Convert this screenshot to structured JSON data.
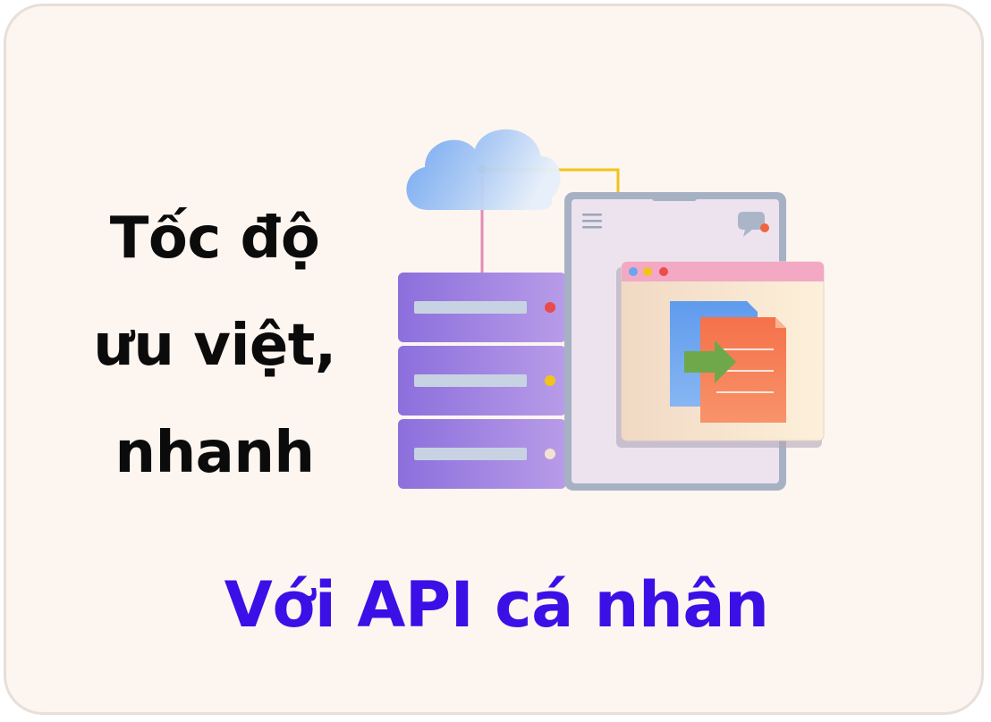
{
  "card": {
    "background": "#fdf5ef",
    "border_color": "#e6dfda"
  },
  "headline": {
    "line1": "Tốc độ",
    "line2": "ưu việt,",
    "line3": "nhanh",
    "color": "#0b0b0b"
  },
  "subtitle": {
    "text": "Với API cá nhân",
    "color": "#3a10e6"
  },
  "illustration": {
    "description_icons": [
      "cloud-icon",
      "server-stack-icon",
      "browser-window-icon",
      "document-transfer-icon",
      "chat-bubble-icon",
      "menu-icon"
    ],
    "colors": {
      "cloud": "#7fb1f3",
      "server": "#9a7ee0",
      "window_frame": "#a9b3c6",
      "document_front": "#f57b55",
      "document_back": "#6ea6f0",
      "arrow": "#6fa84a",
      "cable": "#f1c40f"
    }
  }
}
